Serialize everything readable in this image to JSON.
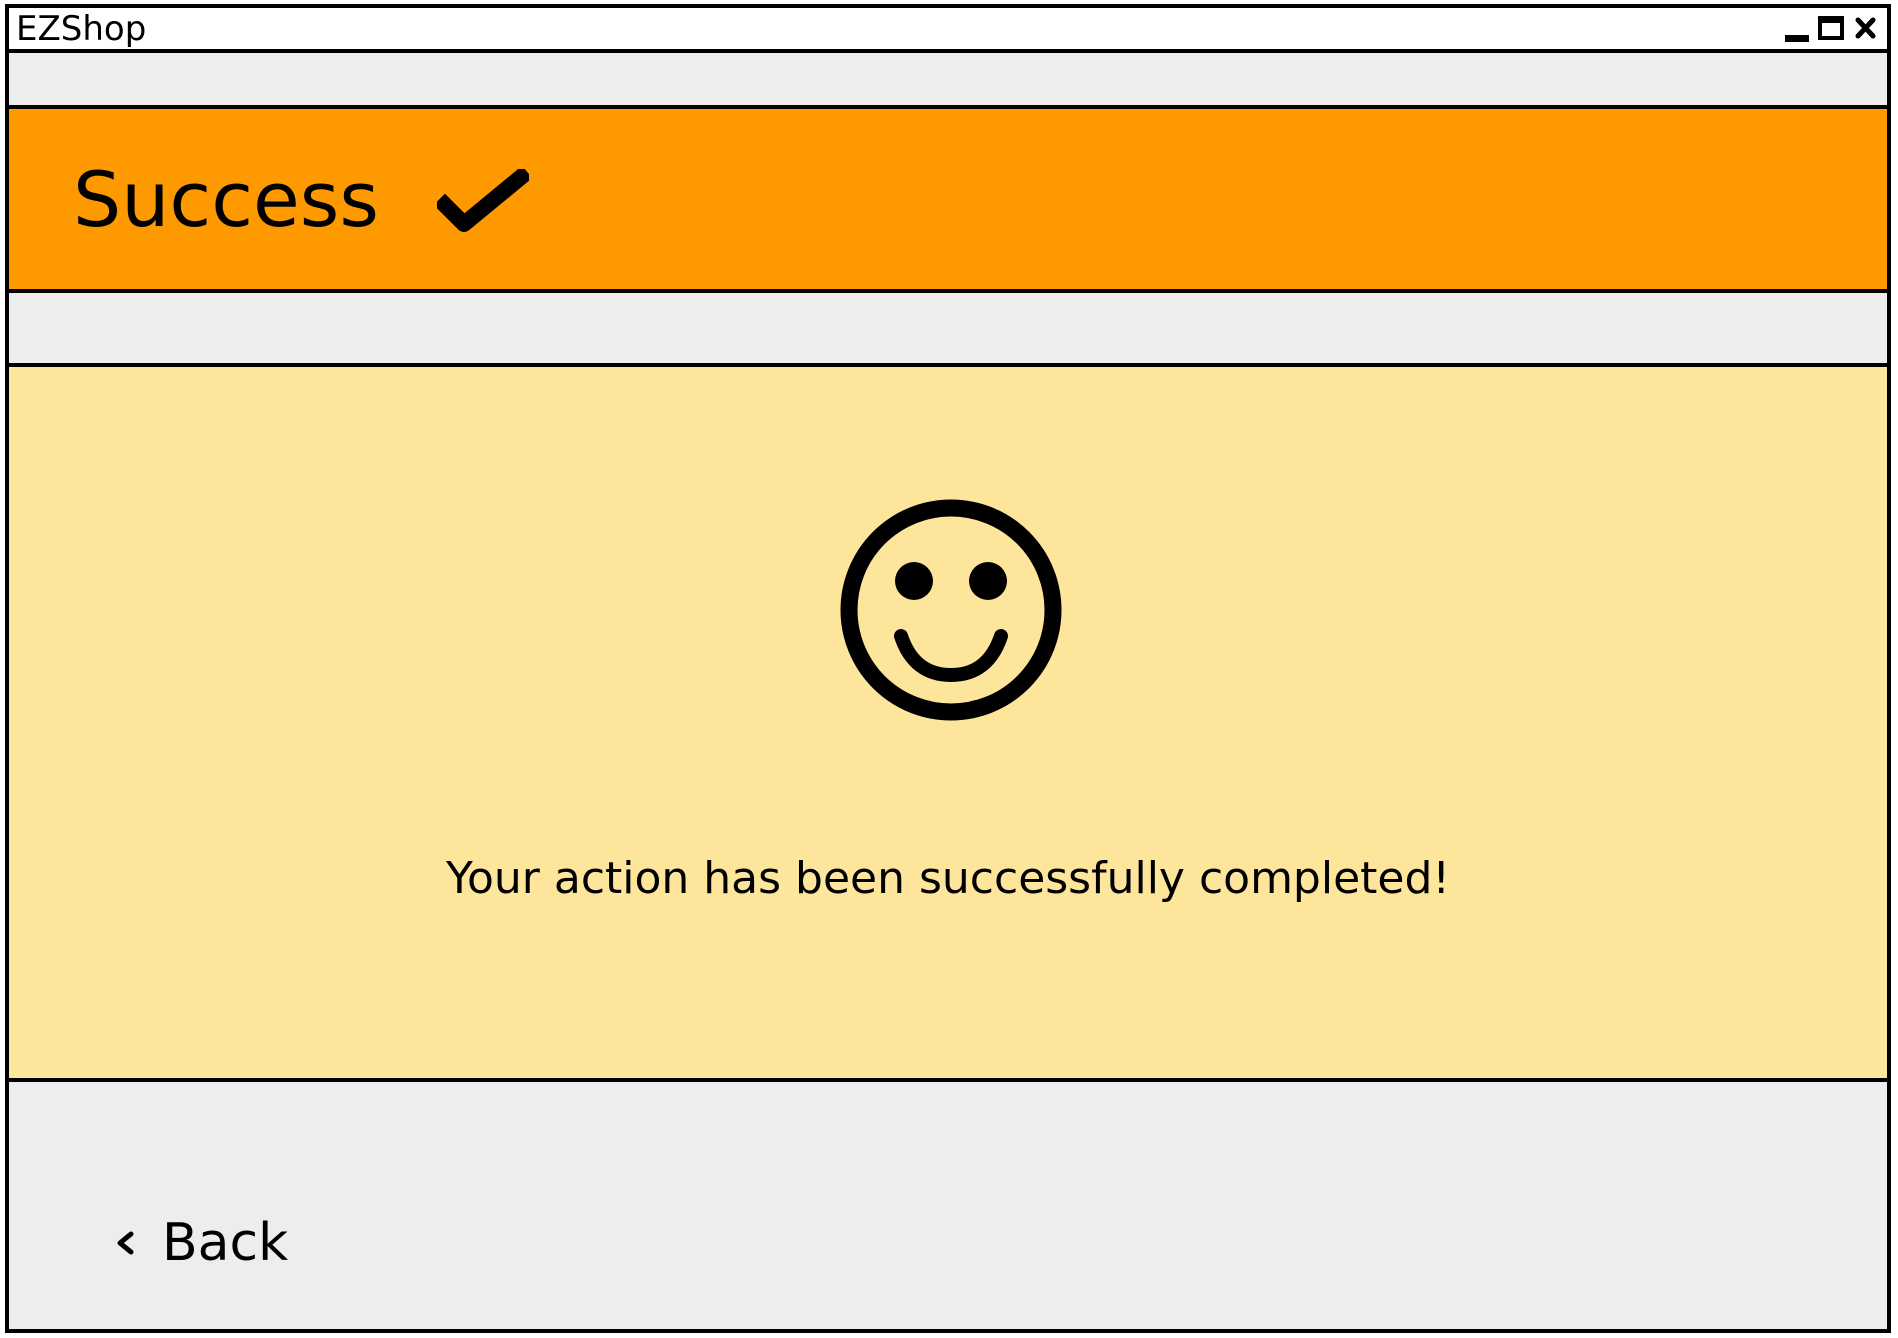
{
  "window": {
    "title": "EZShop",
    "controls": {
      "minimize_icon": "minimize-icon",
      "maximize_icon": "maximize-icon",
      "close_icon": "close-icon"
    }
  },
  "header": {
    "title": "Success",
    "icon": "check-icon",
    "background_color": "#ff9900"
  },
  "content": {
    "icon": "smiley-icon",
    "message": "Your action has been successfully completed!",
    "background_color": "#fde59b"
  },
  "footer": {
    "back_label": "Back",
    "back_icon": "chevron-left-icon",
    "background_color": "#ededed"
  }
}
